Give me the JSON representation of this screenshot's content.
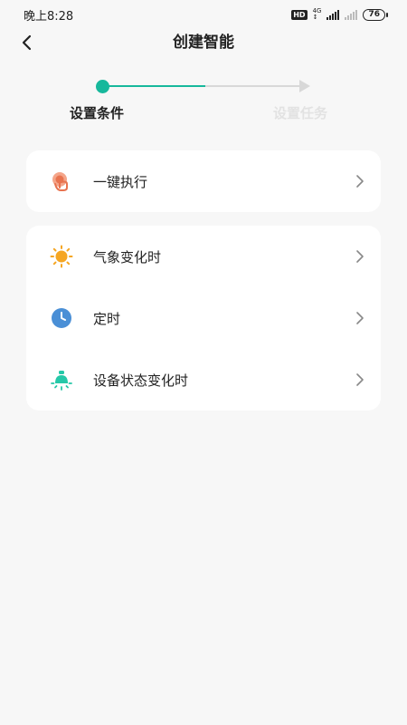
{
  "status_bar": {
    "time": "晚上8:28",
    "hd": "HD",
    "network": "4G",
    "battery": "76"
  },
  "header": {
    "title": "创建智能"
  },
  "stepper": {
    "steps": [
      {
        "label": "设置条件",
        "state": "active"
      },
      {
        "label": "设置任务",
        "state": "inactive"
      }
    ],
    "active_color": "#17b89c",
    "inactive_color": "#d8d8d8"
  },
  "conditions": {
    "group1": [
      {
        "label": "一键执行",
        "icon": "tap-hand-icon",
        "color": "#e8734f"
      }
    ],
    "group2": [
      {
        "label": "气象变化时",
        "icon": "sun-icon",
        "color": "#f5a623"
      },
      {
        "label": "定时",
        "icon": "clock-icon",
        "color": "#4a8fd6"
      },
      {
        "label": "设备状态变化时",
        "icon": "device-lamp-icon",
        "color": "#25c8a8"
      }
    ]
  }
}
